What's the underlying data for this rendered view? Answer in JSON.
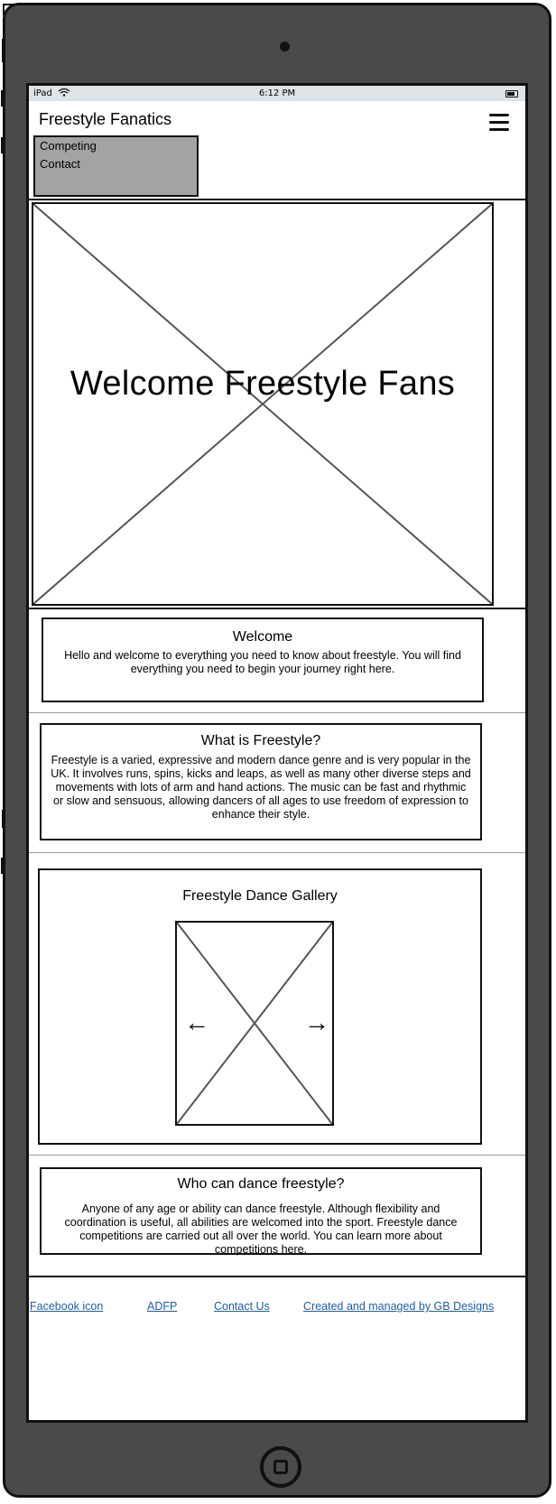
{
  "status_bar": {
    "device": "iPad",
    "time": "6:12 PM"
  },
  "header": {
    "site_title": "Freestyle Fanatics",
    "menu_icon": "hamburger-menu-icon",
    "dropdown_items": [
      {
        "label": "Competing"
      },
      {
        "label": "Contact"
      }
    ]
  },
  "hero": {
    "title": "Welcome Freestyle Fans"
  },
  "sections": {
    "welcome": {
      "heading": "Welcome",
      "body": "Hello and welcome to everything you need to know about freestyle. You will find everything you need to begin your journey right here."
    },
    "what_is": {
      "heading": "What is Freestyle?",
      "body": "Freestyle is a varied, expressive and modern dance genre and is very popular in the UK. It involves runs, spins, kicks and leaps, as well as many other diverse steps and movements with lots of arm and hand actions. The music can be fast and rhythmic or slow and sensuous, allowing dancers of all ages to use freedom of expression to enhance their style."
    },
    "gallery": {
      "heading": "Freestyle Dance Gallery",
      "prev_arrow": "←",
      "next_arrow": "→"
    },
    "who_can": {
      "heading": "Who can dance freestyle?",
      "body": "Anyone of any age or ability can dance freestyle. Although flexibility and coordination is useful, all abilities are welcomed into the sport. Freestyle dance competitions are carried out all over the world. You can learn more about competitions here."
    }
  },
  "footer": {
    "links": [
      {
        "label": "Facebook icon"
      },
      {
        "label": "ADFP"
      },
      {
        "label": "Contact Us"
      },
      {
        "label": "Created and managed by GB Designs"
      }
    ]
  },
  "colors": {
    "device_frame": "#4a4a4a",
    "status_bar": "#dde3e6",
    "dropdown": "#a3a3a3",
    "link": "#1a5fa8"
  }
}
